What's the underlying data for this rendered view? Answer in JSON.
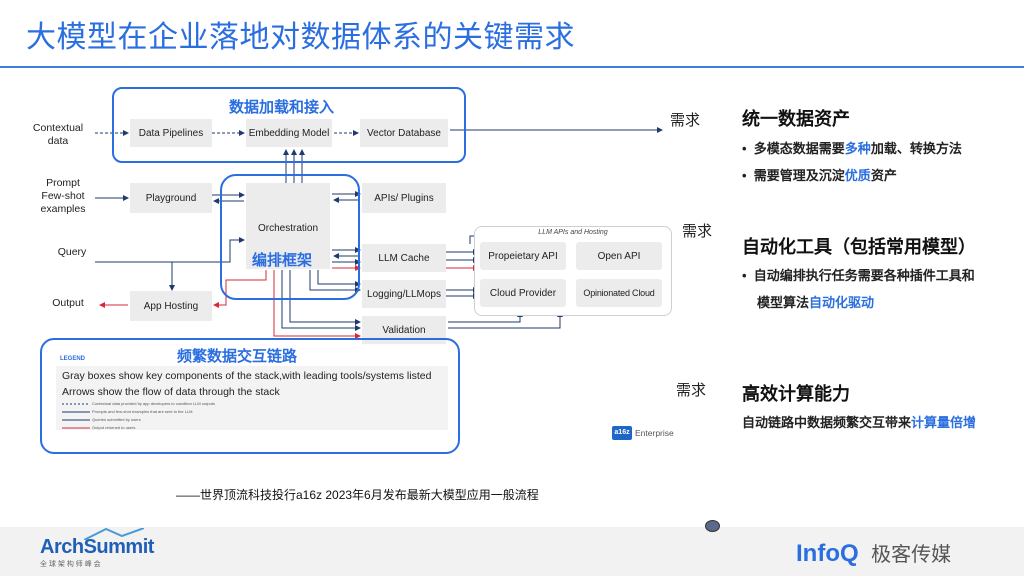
{
  "title": "大模型在企业落地对数据体系的关键需求",
  "diagram": {
    "inputs": {
      "contextual": "Contextual\ndata",
      "prompt": "Prompt\nFew-shot\nexamples",
      "query": "Query",
      "output": "Output"
    },
    "boxes": {
      "data_pipelines": "Data Pipelines",
      "embedding_model": "Embedding Model",
      "vector_database": "Vector Database",
      "playground": "Playground",
      "orchestration": "Orchestration",
      "apis_plugins": "APIs/ Plugins",
      "llm_cache": "LLM Cache",
      "logging": "Logging/LLMops",
      "app_hosting": "App Hosting",
      "validation": "Validation"
    },
    "llm_group": {
      "title": "LLM APIs and Hosting",
      "proprietary": "Propeietary API",
      "open_api": "Open API",
      "cloud_provider": "Cloud Provider",
      "opinionated": "Opinionated Cloud"
    },
    "frames": {
      "data_ingest": "数据加载和接入",
      "orchestration": "编排框架",
      "interaction": "频繁数据交互链路"
    },
    "legend": {
      "heading": "LEGEND",
      "line1": "Gray boxes show key components of the stack,with leading tools/systems listed",
      "line2": "Arrows show the flow of data through the stack",
      "items": [
        "Contextual data provided by app developers to condition LLM outputs",
        "Prompts and few-shot examples that are sent to the LLM",
        "Queries submitted by users",
        "Output returned to users"
      ]
    },
    "brand_mark": "a16z",
    "brand_text": "Enterprise",
    "caption": "——世界顶流科技投行a16z 2023年6月发布最新大模型应用一般流程"
  },
  "needs": {
    "label": "需求",
    "s1": {
      "title": "统一数据资产",
      "b1": {
        "pre": "多模态数据需要",
        "hl": "多种",
        "post": "加载、转换方法"
      },
      "b2": {
        "pre": "需要管理及沉淀",
        "hl": "优质",
        "post": "资产"
      }
    },
    "s2": {
      "title": "自动化工具（包括常用模型）",
      "b1": "自动编排执行任务需要各种插件工具和",
      "b1_cont": {
        "pre": "模型算法",
        "hl": "自动化驱动"
      }
    },
    "s3": {
      "title": "高效计算能力",
      "b1": {
        "pre": "自动链路中数据频繁交互带来",
        "hl": "计算量倍增"
      }
    }
  },
  "footer": {
    "archsummit": "ArchSummit",
    "archsummit_sub": "全 球 架 构 师 峰 会",
    "infoq": "InfoQ",
    "infoq_cn": "极客传媒"
  },
  "colors": {
    "accent": "#2a6ee0",
    "red_arrow": "#d8283a",
    "navy_arrow": "#1f3a6e",
    "gray_box": "#ececec"
  }
}
